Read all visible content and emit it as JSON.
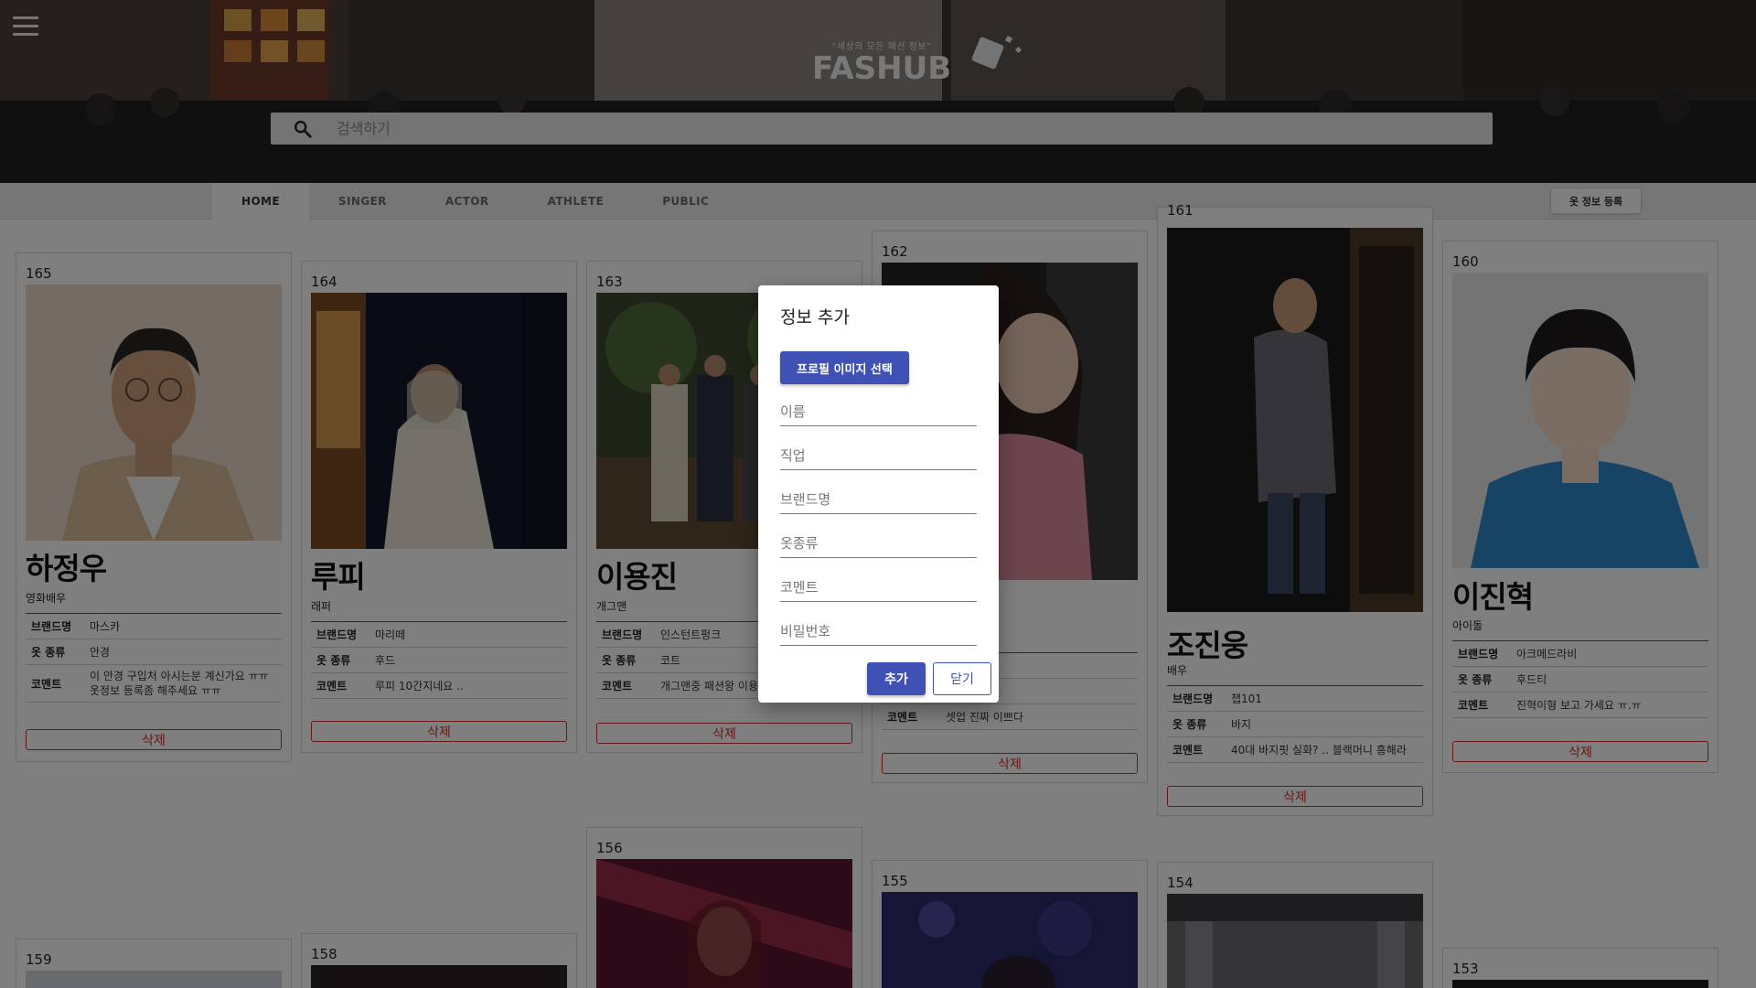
{
  "header": {
    "menu_icon": "hamburger-menu-icon",
    "logo_tagline": "“세상의 모든 패션 정보”",
    "logo_name": "FASHUB",
    "search": {
      "placeholder": "검색하기",
      "value": "",
      "icon": "search-icon"
    }
  },
  "nav": {
    "tabs": [
      {
        "label": "HOME",
        "active": true
      },
      {
        "label": "SINGER",
        "active": false
      },
      {
        "label": "ACTOR",
        "active": false
      },
      {
        "label": "ATHLETE",
        "active": false
      },
      {
        "label": "PUBLIC",
        "active": false
      }
    ],
    "register_label": "옷 정보 등록"
  },
  "card_labels": {
    "brand": "브랜드명",
    "clothes": "옷 종류",
    "comment": "코멘트",
    "delete": "삭제"
  },
  "cards": [
    {
      "num": "165",
      "name": "하정우",
      "job": "영화배우",
      "brand": "마스카",
      "clothes": "안경",
      "comment": "이 안경 구입처 아시는분 계신가요 ㅠㅠ 옷정보 등록좀 해주세요 ㅠㅠ"
    },
    {
      "num": "164",
      "name": "루피",
      "job": "래퍼",
      "brand": "마리떼",
      "clothes": "후드",
      "comment": "루피 10간지네요 .."
    },
    {
      "num": "163",
      "name": "이용진",
      "job": "개그맨",
      "brand": "인스턴트펑크",
      "clothes": "코트",
      "comment": "개그맨중 패션왕 이용진"
    },
    {
      "num": "162",
      "name": "",
      "job": "",
      "brand": "",
      "clothes": "",
      "comment": "셋업 진짜 이쁘다"
    },
    {
      "num": "161",
      "name": "조진웅",
      "job": "배우",
      "brand": "챕101",
      "clothes": "바지",
      "comment": "40대 바지핏 실화? .. 블랙머니 흥해라"
    },
    {
      "num": "160",
      "name": "이진혁",
      "job": "아이돌",
      "brand": "아크메드라비",
      "clothes": "후드티",
      "comment": "진혁이형 보고 가세요 ㅠ.ㅠ"
    },
    {
      "num": "159"
    },
    {
      "num": "158"
    },
    {
      "num": "156"
    },
    {
      "num": "155"
    },
    {
      "num": "154"
    },
    {
      "num": "153"
    }
  ],
  "modal": {
    "title": "정보 추가",
    "pick_image_label": "프로필 이미지 선택",
    "fields": [
      {
        "placeholder": "이름",
        "value": ""
      },
      {
        "placeholder": "직업",
        "value": ""
      },
      {
        "placeholder": "브랜드명",
        "value": ""
      },
      {
        "placeholder": "옷종류",
        "value": ""
      },
      {
        "placeholder": "코멘트",
        "value": ""
      },
      {
        "placeholder": "비밀번호",
        "value": ""
      }
    ],
    "add_label": "추가",
    "close_label": "닫기"
  },
  "colors": {
    "primary": "#3f51b5",
    "danger": "#c8302f",
    "overlay": "rgba(0,0,0,0.5)"
  }
}
